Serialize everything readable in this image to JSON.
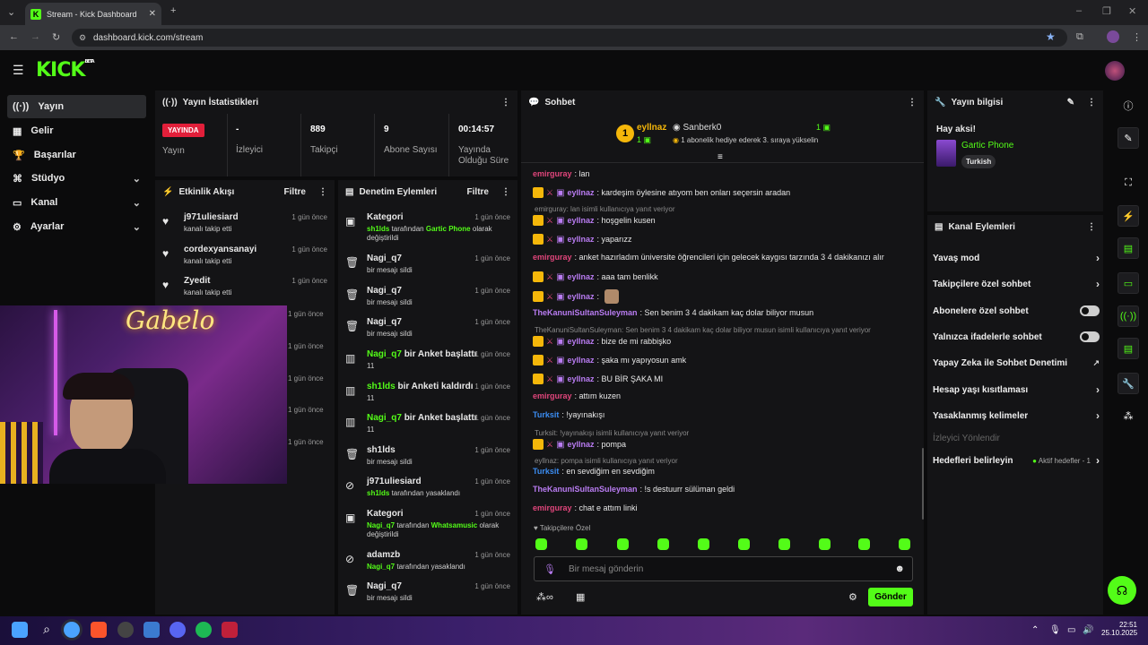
{
  "browser": {
    "tab_title": "Stream - Kick Dashboard",
    "url": "dashboard.kick.com/stream"
  },
  "logo": {
    "text": "KICK",
    "beta": "BETA"
  },
  "sidebar": {
    "items": [
      {
        "label": "Yayın",
        "icon": "stream-icon"
      },
      {
        "label": "Gelir",
        "icon": "revenue-icon"
      },
      {
        "label": "Başarılar",
        "icon": "trophy-icon"
      },
      {
        "label": "Stüdyo",
        "icon": "studio-icon"
      },
      {
        "label": "Kanal",
        "icon": "channel-icon"
      },
      {
        "label": "Ayarlar",
        "icon": "gear-icon"
      }
    ]
  },
  "stats": {
    "title": "Yayın İstatistikleri",
    "live": "YAYINDA",
    "live_label": "Yayın",
    "viewers": "-",
    "viewers_label": "İzleyici",
    "followers": "889",
    "followers_label": "Takipçi",
    "subs": "9",
    "subs_label": "Abone Sayısı",
    "duration": "00:14:57",
    "duration_label": "Yayında Olduğu Süre"
  },
  "activity": {
    "title": "Etkinlik Akışı",
    "filter": "Filtre",
    "items": [
      {
        "name": "j971uliesiard",
        "sub": "kanalı takip etti",
        "time": "1 gün önce"
      },
      {
        "name": "cordexyansanayi",
        "sub": "kanalı takip etti",
        "time": "1 gün önce"
      },
      {
        "name": "Zyedit",
        "sub": "kanalı takip etti",
        "time": "1 gün önce"
      }
    ],
    "hidden_times": [
      "1 gün önce",
      "1 gün önce",
      "1 gün önce",
      "1 gün önce",
      "1 gün önce"
    ]
  },
  "mod": {
    "title": "Denetim Eylemleri",
    "filter": "Filtre",
    "items": [
      {
        "name": "Kategori",
        "time": "1 gün önce",
        "u": "sh1lds",
        "t1": "tarafından",
        "g2": "Gartic Phone",
        "t2": "olarak",
        "t3": "değiştirildi"
      },
      {
        "name": "Nagi_q7",
        "time": "1 gün önce",
        "t1": "bir mesajı sildi"
      },
      {
        "name": "Nagi_q7",
        "time": "1 gün önce",
        "t1": "bir mesajı sildi"
      },
      {
        "name": "Nagi_q7",
        "time": "1 gün önce",
        "t1": "bir mesajı sildi"
      },
      {
        "gname": "Nagi_q7",
        "name": "bir Anket başlattı",
        "time": "1 gün önce",
        "t1": "11"
      },
      {
        "gname": "sh1lds",
        "name": "bir Anketi kaldırdı",
        "time": "1 gün önce",
        "t1": "11"
      },
      {
        "gname": "Nagi_q7",
        "name": "bir Anket başlattı",
        "time": "1 gün önce",
        "t1": "11"
      },
      {
        "name": "sh1lds",
        "time": "1 gün önce",
        "t1": "bir mesajı sildi"
      },
      {
        "name": "j971uliesiard",
        "time": "1 gün önce",
        "u": "sh1lds",
        "t1": "tarafından yasaklandı"
      },
      {
        "name": "Kategori",
        "time": "1 gün önce",
        "u": "Nagi_q7",
        "t1": "tarafından",
        "g2": "Whatsamusic",
        "t2": "olarak",
        "t3": "değiştirildi"
      },
      {
        "name": "adamzb",
        "time": "1 gün önce",
        "u": "Nagi_q7",
        "t1": "tarafından yasaklandı"
      },
      {
        "name": "Nagi_q7",
        "time": "1 gün önce",
        "t1": "bir mesajı sildi"
      }
    ]
  },
  "chat": {
    "title": "Sohbet",
    "top1_name": "eyllnaz",
    "top1_count": "1",
    "top2_name": "Sanberk0",
    "top2_count": "1",
    "gift_text": "1 abonelik hediye ederek 3. sıraya yükselin",
    "messages": [
      {
        "type": "msg",
        "user": "emirguray",
        "cls": "u-em",
        "text": ": lan"
      },
      {
        "type": "msg",
        "badges": true,
        "user": "eyllnaz",
        "cls": "u-ey",
        "text": ": kardeşim öylesine atıyom ben onları seçersin aradan"
      },
      {
        "type": "reply",
        "text": "emirguray: lan isimli kullanıcıya yanıt veriyor"
      },
      {
        "type": "msg",
        "badges": true,
        "user": "eyllnaz",
        "cls": "u-ey",
        "text": ": hoşgelin kusen"
      },
      {
        "type": "msg",
        "badges": true,
        "user": "eyllnaz",
        "cls": "u-ey",
        "text": ": yaparızz"
      },
      {
        "type": "msg",
        "user": "emirguray",
        "cls": "u-em",
        "text": ": anket hazırladım üniversite öğrencileri için gelecek kaygısı tarzında 3 4 dakikanızı alır"
      },
      {
        "type": "msg",
        "badges": true,
        "user": "eyllnaz",
        "cls": "u-ey",
        "text": ": aaa tam benlikk"
      },
      {
        "type": "msg",
        "badges": true,
        "user": "eyllnaz",
        "cls": "u-ey",
        "text": ":"
      },
      {
        "type": "msg",
        "user": "TheKanuniSultanSuleyman",
        "cls": "u-ka",
        "text": ": Sen benim 3 4 dakikam kaç dolar biliyor musun"
      },
      {
        "type": "reply",
        "text": "TheKanuniSultanSuleyman: Sen benim 3 4 dakikam kaç dolar biliyor musun isimli kullanıcıya yanıt veriyor"
      },
      {
        "type": "msg",
        "badges": true,
        "user": "eyllnaz",
        "cls": "u-ey",
        "text": ": bize de mi rabbişko"
      },
      {
        "type": "msg",
        "badges": true,
        "user": "eyllnaz",
        "cls": "u-ey",
        "text": ": şaka mı yapıyosun amk"
      },
      {
        "type": "msg",
        "badges": true,
        "user": "eyllnaz",
        "cls": "u-ey",
        "text": ": BU BİR ŞAKA MI"
      },
      {
        "type": "msg",
        "user": "emirguray",
        "cls": "u-em",
        "text": ": attım kuzen"
      },
      {
        "type": "msg",
        "user": "Turksit",
        "cls": "u-tu",
        "text": ": !yayınakışı"
      },
      {
        "type": "reply",
        "text": "Turksit: !yayınakışı isimli kullanıcıya yanıt veriyor"
      },
      {
        "type": "msg",
        "badges": true,
        "user": "eyllnaz",
        "cls": "u-ey",
        "text": ": pompa"
      },
      {
        "type": "reply",
        "text": "eyllnaz: pompa isimli kullanıcıya yanıt veriyor"
      },
      {
        "type": "msg",
        "user": "Turksit",
        "cls": "u-tu",
        "text": ": en sevdiğim en sevdiğim"
      },
      {
        "type": "msg",
        "user": "TheKanuniSultanSuleyman",
        "cls": "u-ka",
        "text": ": !s destuurr sülüman geldi"
      },
      {
        "type": "msg",
        "user": "emirguray",
        "cls": "u-em",
        "text": ": chat e attım linki"
      }
    ],
    "follower_only": "Takipçilere Özel",
    "placeholder": "Bir mesaj gönderin",
    "send": "Gönder"
  },
  "info": {
    "title": "Yayın bilgisi",
    "stream_title": "Hay aksi!",
    "category": "Gartic Phone",
    "tag": "Turkish"
  },
  "actions": {
    "title": "Kanal Eylemleri",
    "items": [
      {
        "label": "Yavaş mod",
        "ctl": "arrow"
      },
      {
        "label": "Takipçilere özel sohbet",
        "ctl": "arrow"
      },
      {
        "label": "Abonelere özel sohbet",
        "ctl": "toggle"
      },
      {
        "label": "Yalnızca ifadelerle sohbet",
        "ctl": "toggle"
      },
      {
        "label": "Yapay Zeka ile Sohbet Denetimi",
        "ctl": "ext"
      },
      {
        "label": "Hesap yaşı kısıtlaması",
        "ctl": "arrow"
      },
      {
        "label": "Yasaklanmış kelimeler",
        "ctl": "arrow"
      },
      {
        "label": "İzleyici Yönlendir",
        "ctl": "none"
      },
      {
        "label": "Hedefleri belirleyin",
        "ctl": "arrow",
        "extra": "Aktif hedefler - 1"
      }
    ]
  },
  "webcam": {
    "neon_text": "Gabelo"
  },
  "taskbar": {
    "time": "22:51",
    "date": "25.10.2025"
  }
}
